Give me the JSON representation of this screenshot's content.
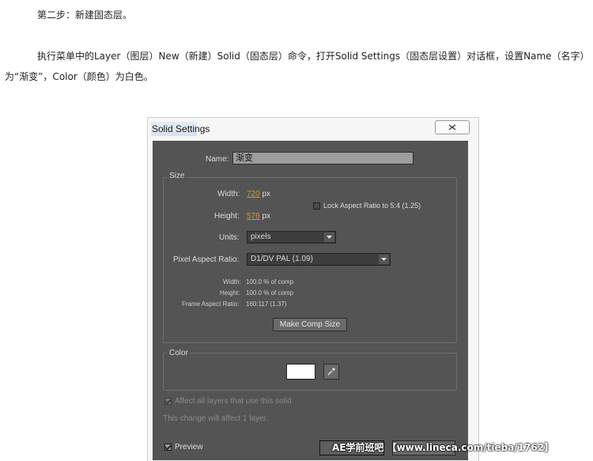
{
  "document": {
    "step_heading": "第二步：新建固态层。",
    "para_line1": "执行菜单中的Layer（图层）New（新建）Solid（固态层）命令，打开Solid Settings（固态层设置）对话框，设置Name（名字）",
    "para_line2": "为“渐变”，Color（颜色）为白色。"
  },
  "dialog": {
    "title": "Solid Settings",
    "name_label": "Name:",
    "name_value": "渐变",
    "size_group": "Size",
    "width_label": "Width:",
    "width_value": "720",
    "width_unit": "px",
    "height_label": "Height:",
    "height_value": "576",
    "height_unit": "px",
    "lock_aspect_label": "Lock Aspect Ratio to 5:4 (1.25)",
    "lock_aspect_checked": false,
    "units_label": "Units:",
    "units_value": "pixels",
    "pixel_aspect_label": "Pixel Aspect Ratio:",
    "pixel_aspect_value": "D1/DV PAL (1.09)",
    "info": {
      "width_label": "Width:",
      "width_value": "100.0 % of comp",
      "height_label": "Height:",
      "height_value": "100.0 % of comp",
      "frame_aspect_label": "Frame Aspect Ratio:",
      "frame_aspect_value": "160:117 (1.37)"
    },
    "make_comp_size_button": "Make Comp Size",
    "color_group": "Color",
    "color_swatch": "#ffffff",
    "affect_all_label": "Affect all layers that use this solid",
    "affect_note": "This change will affect 1 layer.",
    "preview_label": "Preview",
    "preview_checked": true,
    "ok_button_partial": "O",
    "close_icon": "close-x-icon",
    "eyedropper_icon": "eyedropper-icon"
  },
  "watermark": "AE学前班吧  【www.lineca.com/tieba/1762】",
  "colors": {
    "panel_bg": "#545454",
    "value_link": "#d69a2c",
    "input_bg": "#9d9d9d"
  }
}
